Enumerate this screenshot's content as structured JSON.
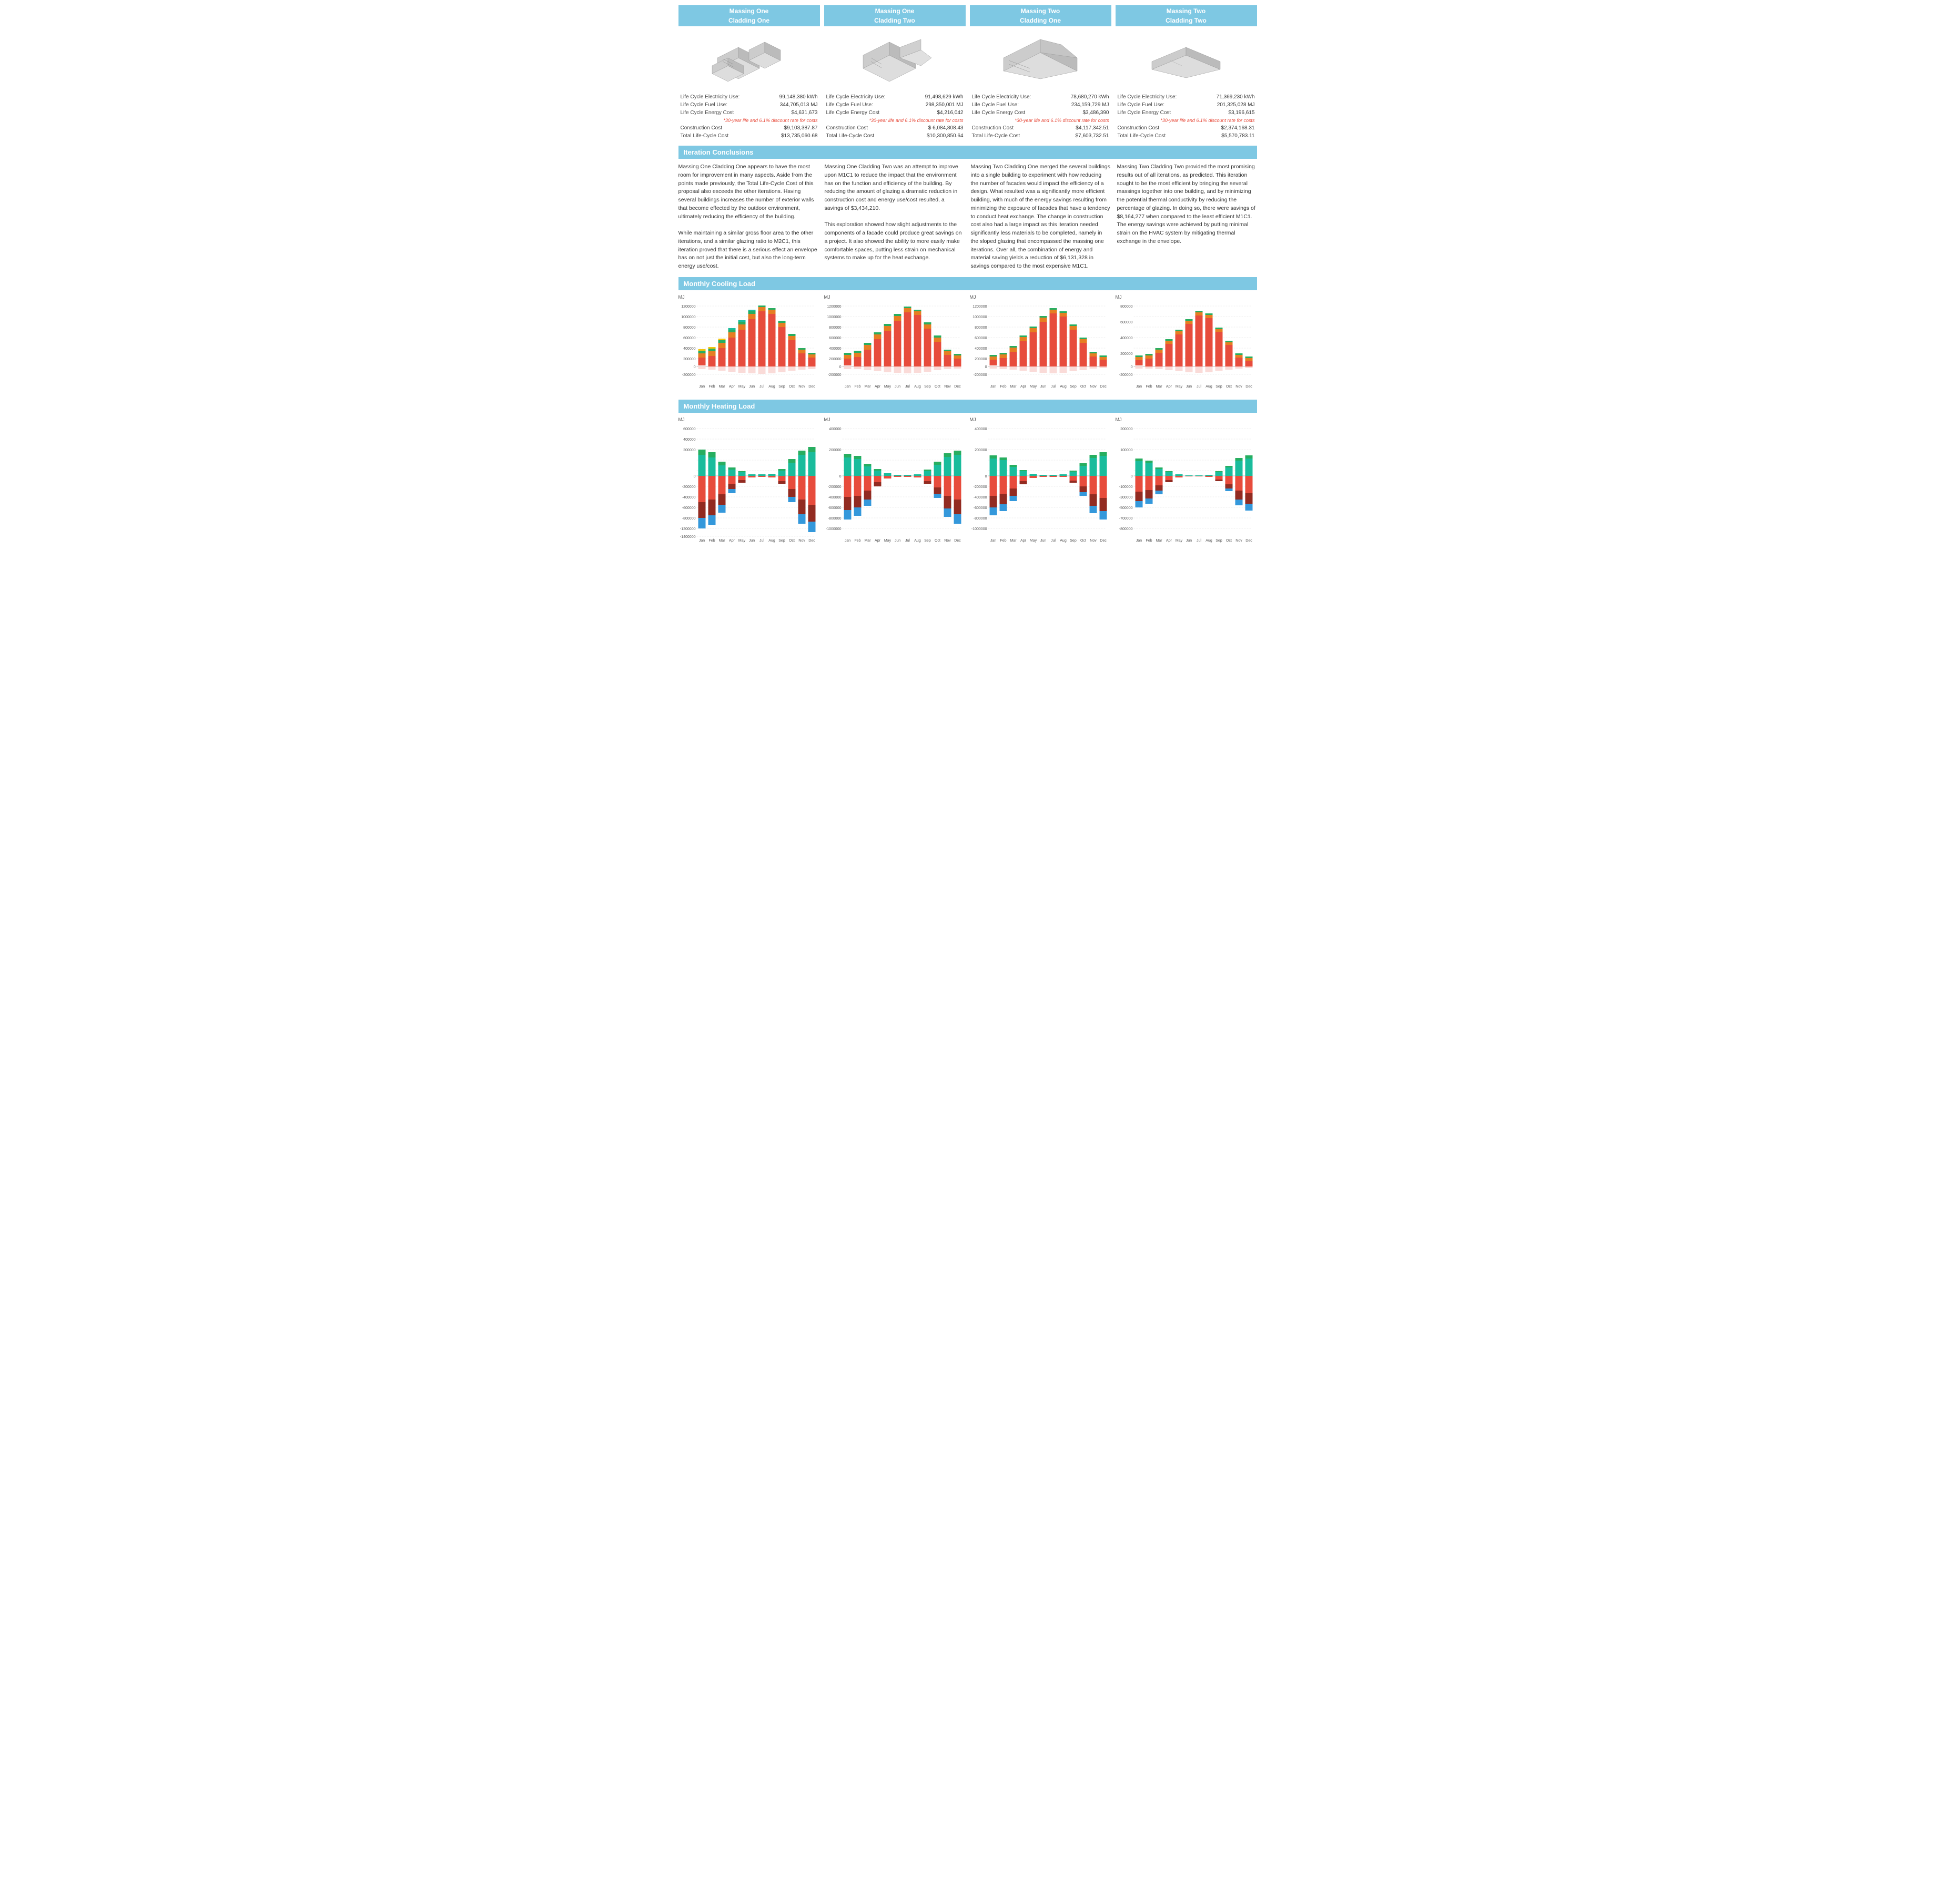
{
  "massings": [
    {
      "id": "m1c1",
      "title_line1": "Massing  One",
      "title_line2": "Cladding One",
      "stats": {
        "electricity_label": "Life Cycle Electricity Use:",
        "electricity_value": "99,148,380 kWh",
        "fuel_label": "Life Cycle Fuel Use:",
        "fuel_value": "344,705,013 MJ",
        "energy_cost_label": "Life Cycle Energy Cost",
        "energy_cost_value": "$4,631,673",
        "discount_note": "*30-year life and 6.1% discount rate for costs",
        "construction_label": "Construction Cost",
        "construction_value": "$9,103,387.87",
        "lifecycle_label": "Total Life-Cycle Cost",
        "lifecycle_value": "$13,735,060.68"
      }
    },
    {
      "id": "m1c2",
      "title_line1": "Massing  One",
      "title_line2": "Cladding Two",
      "stats": {
        "electricity_label": "Life Cycle Electricity Use:",
        "electricity_value": "91,498,629 kWh",
        "fuel_label": "Life Cycle Fuel Use:",
        "fuel_value": "298,350,001 MJ",
        "energy_cost_label": "Life Cycle Energy Cost",
        "energy_cost_value": "$4,216,042",
        "discount_note": "*30-year life and 6.1% discount rate for costs",
        "construction_label": "Construction Cost",
        "construction_value": "$ 6,084,808.43",
        "lifecycle_label": "Total Life-Cycle Cost",
        "lifecycle_value": "$10,300,850.64"
      }
    },
    {
      "id": "m2c1",
      "title_line1": "Massing  Two",
      "title_line2": "Cladding One",
      "stats": {
        "electricity_label": "Life Cycle Electricity Use:",
        "electricity_value": "78,680,270 kWh",
        "fuel_label": "Life Cycle Fuel Use:",
        "fuel_value": "234,159,729 MJ",
        "energy_cost_label": "Life Cycle Energy Cost",
        "energy_cost_value": "$3,486,390",
        "discount_note": "*30-year life and 6.1% discount rate for costs",
        "construction_label": "Construction Cost",
        "construction_value": "$4,117,342.51",
        "lifecycle_label": "Total Life-Cycle Cost",
        "lifecycle_value": "$7,603,732.51"
      }
    },
    {
      "id": "m2c2",
      "title_line1": "Massing  Two",
      "title_line2": "Cladding Two",
      "stats": {
        "electricity_label": "Life Cycle Electricity Use:",
        "electricity_value": "71,369,230 kWh",
        "fuel_label": "Life Cycle Fuel Use:",
        "fuel_value": "201,325,028 MJ",
        "energy_cost_label": "Life Cycle Energy Cost",
        "energy_cost_value": "$3,196,615",
        "discount_note": "*30-year life and 6.1% discount rate for costs",
        "construction_label": "Construction Cost",
        "construction_value": "$2,374,168.31",
        "lifecycle_label": "Total Life-Cycle Cost",
        "lifecycle_value": "$5,570,783.11"
      }
    }
  ],
  "section_conclusions_label": "Iteration Conclusions",
  "section_cooling_label": "Monthly Cooling Load",
  "section_heating_label": "Monthly Heating Load",
  "conclusions": [
    "Massing One Cladding One appears to have the most room for improvement in many aspects. Aside from the points made previously, the Total Life-Cycle Cost of this proposal also exceeds the other iterations. Having several buildings increases the number of exterior walls that become effected by the outdoor environment, ultimately reducing the efficiency of the building.\nWhile maintaining a similar gross floor area to the other iterations, and a similar glazing ratio to M2C1, this iteration proved that there is a serious effect an envelope has on not just the initial cost, but also the long-term energy use/cost.",
    "Massing One Cladding Two was an attempt to improve upon M1C1 to reduce the impact that the environment has on the function and efficiency of the building. By reducing the amount of glazing a dramatic reduction in construction cost and energy use/cost resulted, a savings of $3,434,210.\nThis exploration showed how slight adjustments to the components of a facade could produce great savings on a project. It also showed the ability to more easily make comfortable spaces, putting less strain on mechanical systems to make up for the heat exchange.",
    "Massing Two Cladding One merged the several buildings into a single building to experiment with how reducing the number of facades would impact the efficiency of a design. What resulted was a significantly more efficient building, with much of the energy savings resulting from minimizing the exposure of facades that have a tendency to conduct heat exchange. The change in construction cost also had a large impact as this iteration needed significantly less materials to be completed, namely in the sloped glazing that encompassed the massing one iterations. Over all, the combination of energy and material saving yields a reduction of $6,131,328 in savings compared to the most expensive M1C1.",
    "Massing Two Cladding Two provided the most promising results out of all iterations, as predicted. This iteration sought to be the most efficient by bringing the several massings together into one building, and by minimizing the potential thermal conductivity by reducing the percentage of glazing. In doing so, there were savings of $8,164,277 when compared to the least efficient M1C1. The energy savings were achieved by putting minimal strain on the HVAC system by mitigating thermal exchange in the envelope."
  ],
  "months": [
    "Jan",
    "Feb",
    "Mar",
    "Apr",
    "May",
    "Jun",
    "Jul",
    "Aug",
    "Sep",
    "Oct",
    "Nov",
    "Dec"
  ],
  "cooling_unit": "MJ",
  "heating_unit": "MJ",
  "colors": {
    "header_blue": "#7ec8e3",
    "red": "#e74c3c",
    "orange": "#e67e22",
    "green": "#27ae60",
    "teal": "#1abc9c",
    "yellow": "#f1c40f",
    "pink": "#fadbd8",
    "dark_red": "#922b21",
    "blue": "#3498db",
    "dark_green": "#1e8449",
    "purple": "#8e44ad"
  }
}
